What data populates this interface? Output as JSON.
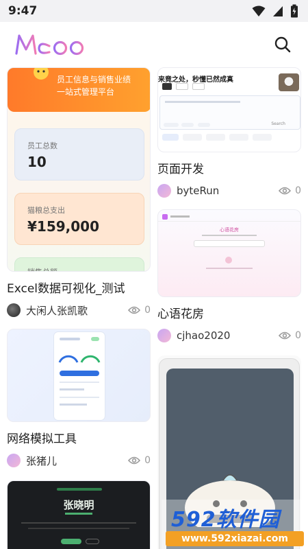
{
  "status_bar": {
    "time": "9:47"
  },
  "header": {
    "logo_text": "Meoo"
  },
  "feed": {
    "left": [
      {
        "title": "Excel数据可视化_测试",
        "author": "大闲人张凯歌",
        "views": "0",
        "preview": {
          "banner_lines": [
            "员工信息与销售业绩",
            "一站式管理平台"
          ],
          "stats": [
            {
              "label": "员工总数",
              "value": "10"
            },
            {
              "label": "猫粮总支出",
              "value": "¥159,000"
            },
            {
              "label": "销售总额",
              "value": ""
            }
          ]
        }
      },
      {
        "title": "网络模拟工具",
        "author": "张猪儿",
        "views": "0"
      },
      {
        "title": "",
        "author": "",
        "views": "",
        "preview": {
          "name": "张晓明"
        }
      }
    ],
    "right": [
      {
        "title": "页面开发",
        "author": "byteRun",
        "views": "0",
        "preview": {
          "headline": "来竟之处，秒懂已然成真",
          "hint": "Search"
        }
      },
      {
        "title": "心语花房",
        "author": "cjhao2020",
        "views": "0",
        "preview": {
          "name": "心语花房"
        }
      }
    ]
  },
  "watermark": {
    "brand": "592软件园",
    "url": "www.592xiazai.com"
  },
  "colors": {
    "accent_orange": "#ff8a2b",
    "logo_purple": "#8e6cf0",
    "logo_pink": "#e979c4"
  }
}
